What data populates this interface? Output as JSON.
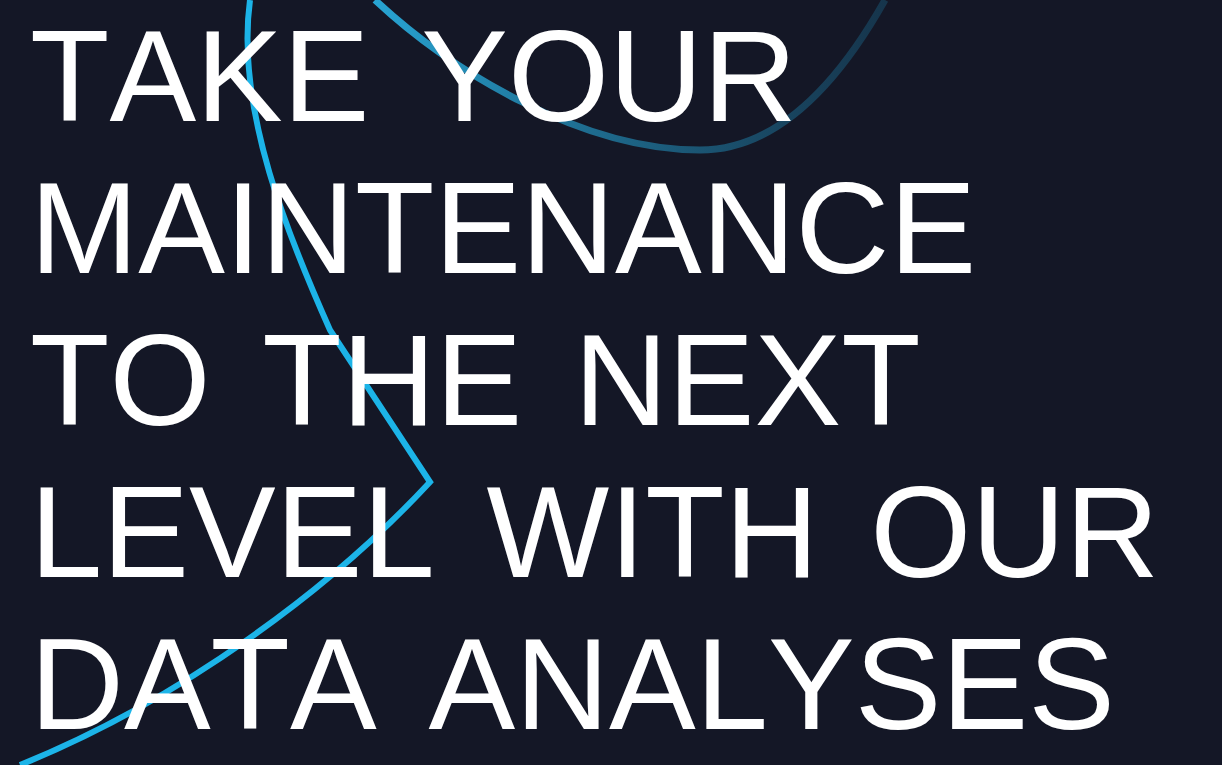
{
  "hero": {
    "heading_lines": [
      "TAKE YOUR",
      "MAINTENANCE",
      "TO THE NEXT",
      "LEVEL WITH OUR",
      "DATA ANALYSES"
    ]
  }
}
